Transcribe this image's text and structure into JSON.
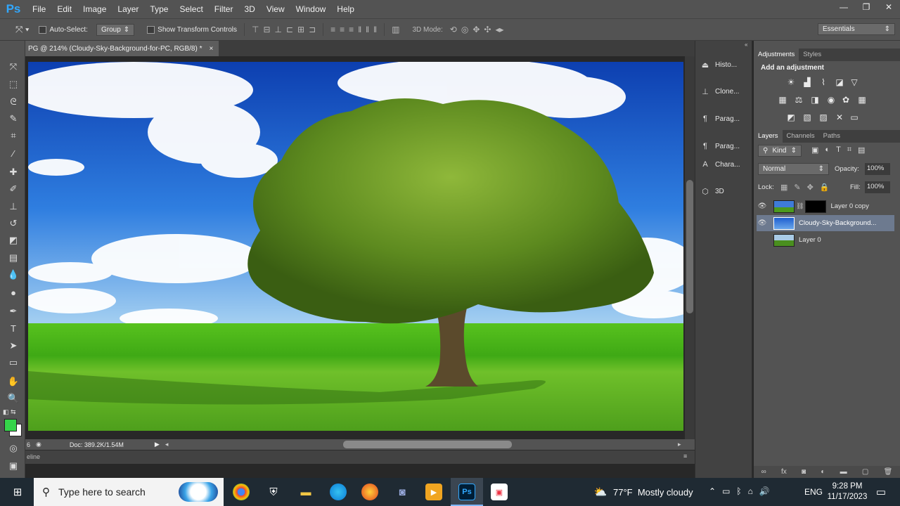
{
  "app": {
    "logo": "Ps"
  },
  "menu": [
    "File",
    "Edit",
    "Image",
    "Layer",
    "Type",
    "Select",
    "Filter",
    "3D",
    "View",
    "Window",
    "Help"
  ],
  "window_controls": [
    "—",
    "❐",
    "✕"
  ],
  "options": {
    "auto_select_label": "Auto-Select:",
    "auto_select_value": "Group",
    "show_transform_label": "Show Transform Controls",
    "mode_3d_label": "3D Mode:",
    "workspace": "Essentials"
  },
  "document": {
    "tab_title": "PG @ 214% (Cloudy-Sky-Background-for-PC, RGB/8) *",
    "tab_close": "×",
    "zoom_status": "6",
    "doc_info": "Doc: 389.2K/1.54M",
    "timeline_label": "eline"
  },
  "collapsed_panels": [
    {
      "label": "Histo...",
      "icon": "history-icon"
    },
    {
      "label": "Clone...",
      "icon": "clone-source-icon"
    },
    {
      "label": "Parag...",
      "icon": "paragraph-icon"
    },
    {
      "label": "Parag...",
      "icon": "paragraph-styles-icon"
    },
    {
      "label": "Chara...",
      "icon": "character-icon"
    },
    {
      "label": "3D",
      "icon": "3d-icon"
    }
  ],
  "adjustments": {
    "tabs": [
      "Adjustments",
      "Styles"
    ],
    "heading": "Add an adjustment"
  },
  "layers_panel": {
    "tabs": [
      "Layers",
      "Channels",
      "Paths"
    ],
    "filter_kind": "Kind",
    "blend_mode": "Normal",
    "opacity_label": "Opacity:",
    "opacity_value": "100%",
    "lock_label": "Lock:",
    "fill_label": "Fill:",
    "fill_value": "100%",
    "layers": [
      {
        "name": "Layer 0 copy",
        "visible": true,
        "selected": false
      },
      {
        "name": "Cloudy-Sky-Background...",
        "visible": true,
        "selected": true
      },
      {
        "name": "Layer 0",
        "visible": false,
        "selected": false
      }
    ]
  },
  "taskbar": {
    "search_placeholder": "Type here to search",
    "weather": "77°F  Mostly cloudy",
    "language": "ENG",
    "time": "9:28 PM",
    "date": "11/17/2023"
  }
}
